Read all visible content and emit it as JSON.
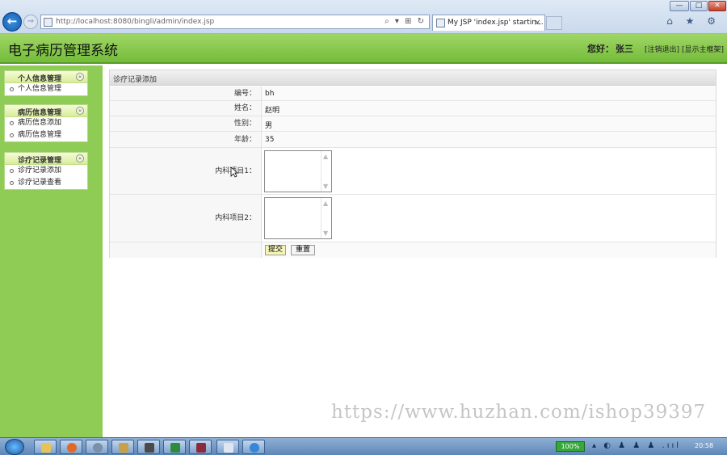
{
  "browser": {
    "url": "http://localhost:8080/bingli/admin/index.jsp",
    "tab_title": "My JSP 'index.jsp' startin...",
    "tab_close": "×",
    "window_min": "—",
    "window_max": "□",
    "window_close": "✕",
    "back_glyph": "←",
    "forward_glyph": "→",
    "address_tools": "⌕ ▾ ⊞ ↻",
    "chrome_icons": "⌂ ★ ⚙"
  },
  "header": {
    "title": "电子病历管理系统",
    "greeting": "您好：",
    "user": "张三",
    "logout": "[注销退出]",
    "home": "[显示主框架]"
  },
  "sidebar": {
    "groups": [
      {
        "title": "个人信息管理",
        "items": [
          "个人信息管理"
        ]
      },
      {
        "title": "病历信息管理",
        "items": [
          "病历信息添加",
          "病历信息管理"
        ]
      },
      {
        "title": "诊疗记录管理",
        "items": [
          "诊疗记录添加",
          "诊疗记录查看"
        ]
      }
    ],
    "collapse_glyph": "«"
  },
  "form": {
    "title": "诊疗记录添加",
    "fields": [
      {
        "label": "编号：",
        "value": "bh"
      },
      {
        "label": "姓名：",
        "value": "赵明"
      },
      {
        "label": "性别：",
        "value": "男"
      },
      {
        "label": "年龄：",
        "value": "35"
      },
      {
        "label": "内科项目1：",
        "value": ""
      },
      {
        "label": "内科项目2：",
        "value": ""
      }
    ],
    "submit": "提交",
    "reset": "重置"
  },
  "watermark": "https://www.huzhan.com/ishop39397",
  "taskbar": {
    "battery": "100%",
    "tray_icons": "▴ ◐ ♟ ♟ ♟ .ııl",
    "clock": "20:58"
  },
  "colors": {
    "header_green": "#8ccc50",
    "sidebar_green": "#8fcc55",
    "submit_yellow": "#f6f5b7"
  }
}
